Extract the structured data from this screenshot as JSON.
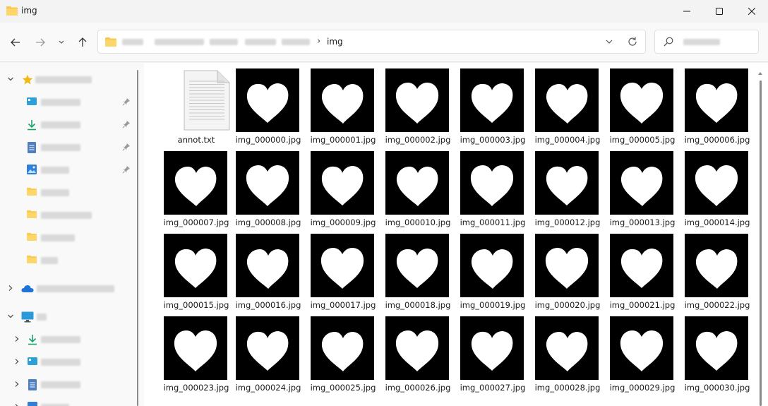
{
  "window": {
    "title": "img",
    "minimize_icon": "minimize-icon",
    "maximize_icon": "maximize-icon",
    "close_icon": "close-icon"
  },
  "navigation": {
    "back_icon": "arrow-left-icon",
    "forward_icon": "arrow-right-icon",
    "recent_icon": "chevron-down-icon",
    "up_icon": "arrow-up-icon"
  },
  "address": {
    "separator": "›",
    "current_folder": "img",
    "dropdown_icon": "chevron-down-icon",
    "refresh_icon": "refresh-icon"
  },
  "search": {
    "icon": "search-icon"
  },
  "sidebar": {
    "quick_access_icon": "star-icon",
    "onedrive_icon": "cloud-icon",
    "this_pc_icon": "monitor-icon"
  },
  "files": [
    {
      "name": "annot.txt",
      "type": "text"
    },
    {
      "name": "img_000000.jpg",
      "type": "image"
    },
    {
      "name": "img_000001.jpg",
      "type": "image"
    },
    {
      "name": "img_000002.jpg",
      "type": "image"
    },
    {
      "name": "img_000003.jpg",
      "type": "image"
    },
    {
      "name": "img_000004.jpg",
      "type": "image"
    },
    {
      "name": "img_000005.jpg",
      "type": "image"
    },
    {
      "name": "img_000006.jpg",
      "type": "image"
    },
    {
      "name": "img_000007.jpg",
      "type": "image"
    },
    {
      "name": "img_000008.jpg",
      "type": "image"
    },
    {
      "name": "img_000009.jpg",
      "type": "image"
    },
    {
      "name": "img_000010.jpg",
      "type": "image"
    },
    {
      "name": "img_000011.jpg",
      "type": "image"
    },
    {
      "name": "img_000012.jpg",
      "type": "image"
    },
    {
      "name": "img_000013.jpg",
      "type": "image"
    },
    {
      "name": "img_000014.jpg",
      "type": "image"
    },
    {
      "name": "img_000015.jpg",
      "type": "image"
    },
    {
      "name": "img_000016.jpg",
      "type": "image"
    },
    {
      "name": "img_000017.jpg",
      "type": "image"
    },
    {
      "name": "img_000018.jpg",
      "type": "image"
    },
    {
      "name": "img_000019.jpg",
      "type": "image"
    },
    {
      "name": "img_000020.jpg",
      "type": "image"
    },
    {
      "name": "img_000021.jpg",
      "type": "image"
    },
    {
      "name": "img_000022.jpg",
      "type": "image"
    },
    {
      "name": "img_000023.jpg",
      "type": "image"
    },
    {
      "name": "img_000024.jpg",
      "type": "image"
    },
    {
      "name": "img_000025.jpg",
      "type": "image"
    },
    {
      "name": "img_000026.jpg",
      "type": "image"
    },
    {
      "name": "img_000027.jpg",
      "type": "image"
    },
    {
      "name": "img_000028.jpg",
      "type": "image"
    },
    {
      "name": "img_000029.jpg",
      "type": "image"
    },
    {
      "name": "img_000030.jpg",
      "type": "image"
    }
  ],
  "colors": {
    "folder_yellow": "#f8c94a",
    "accent_blue": "#1e73d8",
    "download_green": "#1aa36a"
  }
}
